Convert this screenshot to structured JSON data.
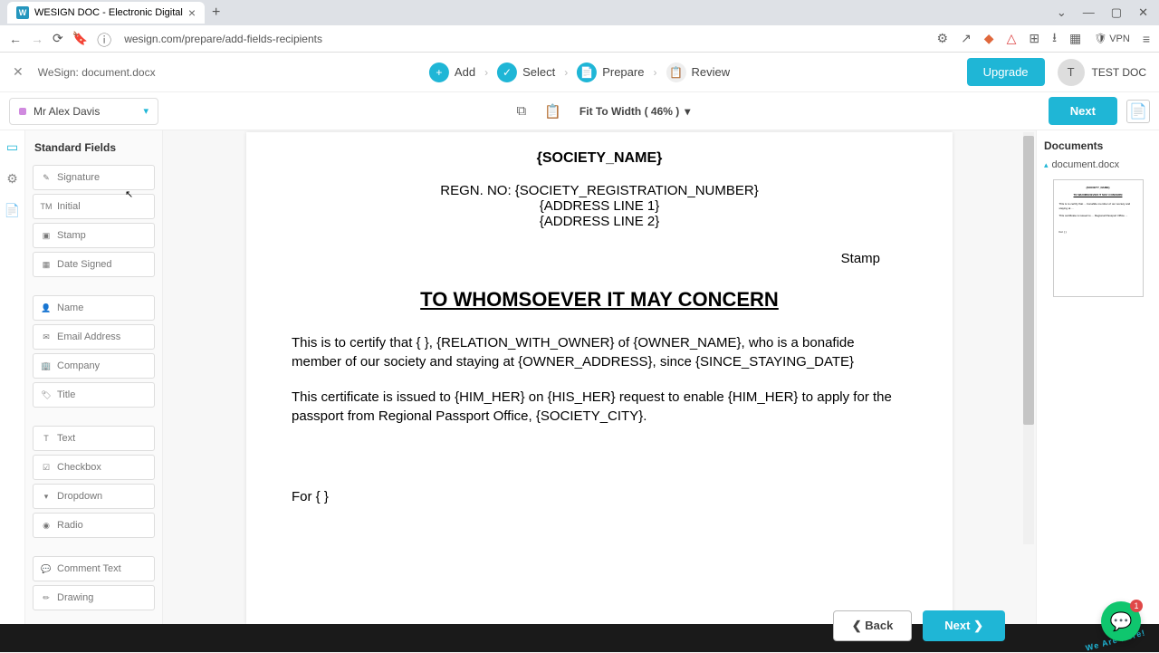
{
  "browser": {
    "tab_title": "WESIGN DOC - Electronic Digital",
    "url": "wesign.com/prepare/add-fields-recipients",
    "vpn": "VPN"
  },
  "app": {
    "doc_label": "WeSign: document.docx",
    "upgrade": "Upgrade",
    "user_initial": "T",
    "user_name": "TEST DOC"
  },
  "stepper": {
    "add": "Add",
    "select": "Select",
    "prepare": "Prepare",
    "review": "Review"
  },
  "toolbar": {
    "recipient": "Mr Alex Davis",
    "zoom": "Fit To Width ( 46% )",
    "next": "Next"
  },
  "fields": {
    "heading": "Standard Fields",
    "items": [
      "Signature",
      "Initial",
      "Stamp",
      "Date Signed",
      "Name",
      "Email Address",
      "Company",
      "Title",
      "Text",
      "Checkbox",
      "Dropdown",
      "Radio",
      "Comment Text",
      "Drawing"
    ]
  },
  "document": {
    "society_name": "{SOCIETY_NAME}",
    "regn_line": "REGN. NO: {SOCIETY_REGISTRATION_NUMBER}",
    "addr1": "{ADDRESS LINE 1}",
    "addr2": "{ADDRESS LINE 2}",
    "stamp": "Stamp",
    "heading": "TO WHOMSOEVER IT MAY CONCERN",
    "para1": "This is to certify that {                                  }, {RELATION_WITH_OWNER} of {OWNER_NAME}, who is a bonafide member of our society and staying at {OWNER_ADDRESS}, since {SINCE_STAYING_DATE}",
    "para2": "This certificate is issued to {HIM_HER} on {HIS_HER} request to enable {HIM_HER} to apply for the passport from Regional Passport Office, {SOCIETY_CITY}.",
    "for_line": "For {                                 }"
  },
  "right": {
    "heading": "Documents",
    "doc_name": "document.docx"
  },
  "buttons": {
    "back": "Back",
    "next": "Next"
  },
  "chat": {
    "badge": "1",
    "arc": "We Are Here!"
  }
}
